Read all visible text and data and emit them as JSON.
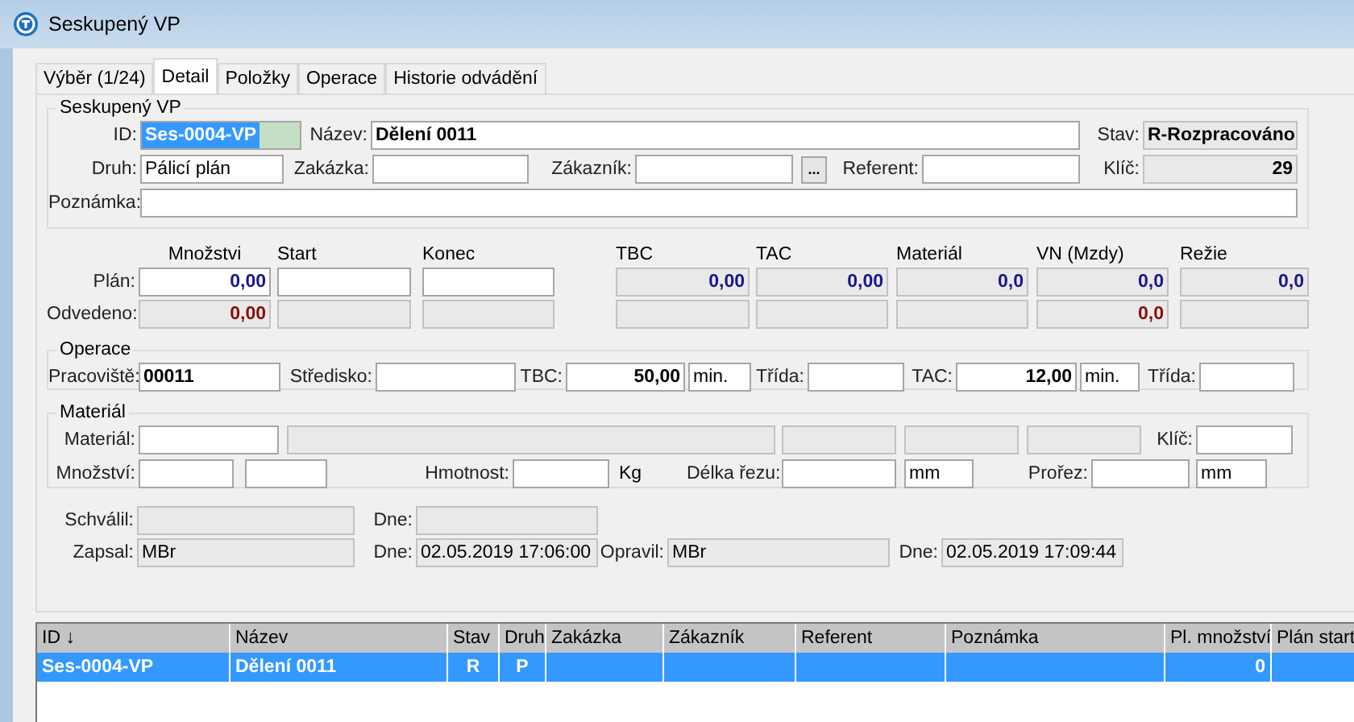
{
  "window": {
    "title": "Seskupený VP"
  },
  "tabs": [
    {
      "label": "Výběr (1/24)",
      "selected": false
    },
    {
      "label": "Detail",
      "selected": true
    },
    {
      "label": "Položky",
      "selected": false
    },
    {
      "label": "Operace",
      "selected": false
    },
    {
      "label": "Historie odvádění",
      "selected": false
    }
  ],
  "header": {
    "legend": "Seskupený VP",
    "id": {
      "label": "ID:",
      "value": "Ses-0004-VP",
      "disabled": false,
      "text_selected": true
    },
    "nazev": {
      "label": "Název:",
      "value": "Dělení 0011",
      "disabled": false
    },
    "stav": {
      "label": "Stav:",
      "value": "R-Rozpracováno",
      "disabled": true
    },
    "druh": {
      "label": "Druh:",
      "value": "Pálicí plán",
      "disabled": false
    },
    "zakazka": {
      "label": "Zakázka:",
      "disabled": false
    },
    "zakaznik": {
      "label": "Zákazník:",
      "disabled": false,
      "button": "..."
    },
    "referent": {
      "label": "Referent:",
      "disabled": false
    },
    "klic": {
      "label": "Klíč:",
      "value": "29",
      "disabled": true
    },
    "poznamka": {
      "label": "Poznámka:",
      "disabled": false
    }
  },
  "plan": {
    "columns": [
      "Množstvi",
      "Start",
      "Konec",
      "TBC",
      "TAC",
      "Materiál",
      "VN (Mzdy)",
      "Režie"
    ],
    "rows": [
      {
        "label": "Plán:",
        "kind": "plan",
        "cells": [
          {
            "value": "0,00",
            "disabled": false
          },
          {
            "disabled": false
          },
          {
            "disabled": false
          },
          {
            "value": "0,00",
            "disabled": true
          },
          {
            "value": "0,00",
            "disabled": true
          },
          {
            "value": "0,0",
            "disabled": true
          },
          {
            "value": "0,0",
            "disabled": true
          },
          {
            "value": "0,0",
            "disabled": true
          }
        ]
      },
      {
        "label": "Odvedeno:",
        "kind": "done",
        "cells": [
          {
            "value": "0,00",
            "disabled": true
          },
          {
            "disabled": true
          },
          {
            "disabled": true
          },
          {
            "disabled": true
          },
          {
            "disabled": true
          },
          {
            "disabled": true
          },
          {
            "value": "0,0",
            "disabled": true
          },
          {
            "disabled": true
          }
        ]
      }
    ]
  },
  "operace": {
    "legend": "Operace",
    "pracoviste": {
      "label": "Pracoviště:",
      "value": "00011",
      "disabled": false
    },
    "stredisko": {
      "label": "Středisko:",
      "disabled": false
    },
    "tbc": {
      "label": "TBC:",
      "value": "50,00",
      "disabled": false
    },
    "tbc_unit": {
      "value": "min.",
      "disabled": false
    },
    "trida_1": {
      "label": "Třída:",
      "disabled": false
    },
    "tac": {
      "label": "TAC:",
      "value": "12,00",
      "disabled": false
    },
    "tac_unit": {
      "value": "min.",
      "disabled": false
    },
    "trida_2": {
      "label": "Třída:",
      "disabled": false
    }
  },
  "material": {
    "legend": "Materiál",
    "material": {
      "label": "Materiál:",
      "disabled": false
    },
    "material_info": [
      {
        "disabled": true
      },
      {
        "disabled": true
      },
      {
        "disabled": true
      },
      {
        "disabled": true
      }
    ],
    "klic": {
      "label": "Klíč:",
      "disabled": false
    },
    "mnozstvi": {
      "label": "Množství:",
      "disabled": false
    },
    "mnozstvi_2": {
      "disabled": false
    },
    "hmotnost": {
      "label": "Hmotnost:",
      "disabled": false
    },
    "hmotnost_unit": "Kg",
    "delka_rezu": {
      "label": "Délka řezu:",
      "disabled": false
    },
    "delka_rezu_unit": {
      "value": "mm",
      "disabled": false
    },
    "prorez": {
      "label": "Prořez:",
      "disabled": false
    },
    "prorez_unit": {
      "value": "mm",
      "disabled": false
    }
  },
  "audit": {
    "schvalil": {
      "label": "Schválil:",
      "disabled": true
    },
    "schvalil_dne": {
      "label": "Dne:",
      "disabled": true
    },
    "zapsal": {
      "label": "Zapsal:",
      "value": "MBr",
      "disabled": true
    },
    "zapsal_dne": {
      "label": "Dne:",
      "value": "02.05.2019 17:06:00",
      "disabled": true
    },
    "opravil": {
      "label": "Opravil:",
      "value": "MBr",
      "disabled": true
    },
    "opravil_dne": {
      "label": "Dne:",
      "value": "02.05.2019 17:09:44",
      "disabled": true
    }
  },
  "table": {
    "columns": [
      "ID ↓",
      "Název",
      "Stav",
      "Druh",
      "Zakázka",
      "Zákazník",
      "Referent",
      "Poznámka",
      "Pl. množství",
      "Plán start"
    ],
    "rows": [
      {
        "selected": true,
        "cells": [
          "Ses-0004-VP",
          "Dělení 0011",
          "R",
          "P",
          "",
          "",
          "",
          "",
          "0",
          ""
        ]
      }
    ]
  }
}
